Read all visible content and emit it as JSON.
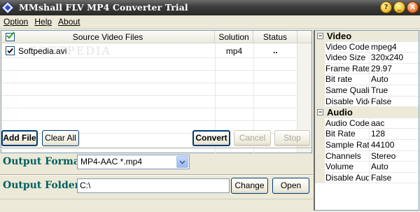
{
  "window": {
    "title": "MMshall FLV MP4 Converter Trial",
    "buttons": [
      "?",
      "_",
      "X"
    ]
  },
  "menu": [
    "Option",
    "Help",
    "About"
  ],
  "file_list": {
    "columns": [
      "Source Video Files",
      "Solution",
      "Status"
    ],
    "rows": [
      {
        "checked": true,
        "name": "Softpedia.avi",
        "solution": "mp4",
        "status": ".."
      }
    ],
    "watermark": "SOFTPEDIA"
  },
  "buttons": {
    "add_file": "Add File",
    "clear_all": "Clear All",
    "convert": "Convert",
    "cancel": "Cancel",
    "stop": "Stop",
    "change": "Change",
    "open": "Open"
  },
  "output": {
    "format_label": "Output Format:",
    "format_value": "MP4-AAC *.mp4",
    "folder_label": "Output Folder:",
    "folder_value": "C:\\"
  },
  "properties": [
    {
      "category": "Video",
      "items": [
        {
          "name": "Video Codec",
          "value": "mpeg4"
        },
        {
          "name": "Video Size",
          "value": "320x240"
        },
        {
          "name": "Frame Rate",
          "value": "29.97"
        },
        {
          "name": "Bit rate",
          "value": "Auto"
        },
        {
          "name": "Same Quality",
          "value": "True"
        },
        {
          "name": "Disable Video",
          "value": "False"
        }
      ]
    },
    {
      "category": "Audio",
      "items": [
        {
          "name": "Audio Codec",
          "value": "aac"
        },
        {
          "name": "Bit Rate",
          "value": "128"
        },
        {
          "name": "Sample Rate",
          "value": "44100"
        },
        {
          "name": "Channels",
          "value": "Stereo"
        },
        {
          "name": "Volume",
          "value": "Auto"
        },
        {
          "name": "Disable Audio",
          "value": "False"
        }
      ]
    }
  ],
  "colors": {
    "field_label": "#006060",
    "title_bar": "#3c3c3c",
    "window_bg": "#ece9d8"
  }
}
